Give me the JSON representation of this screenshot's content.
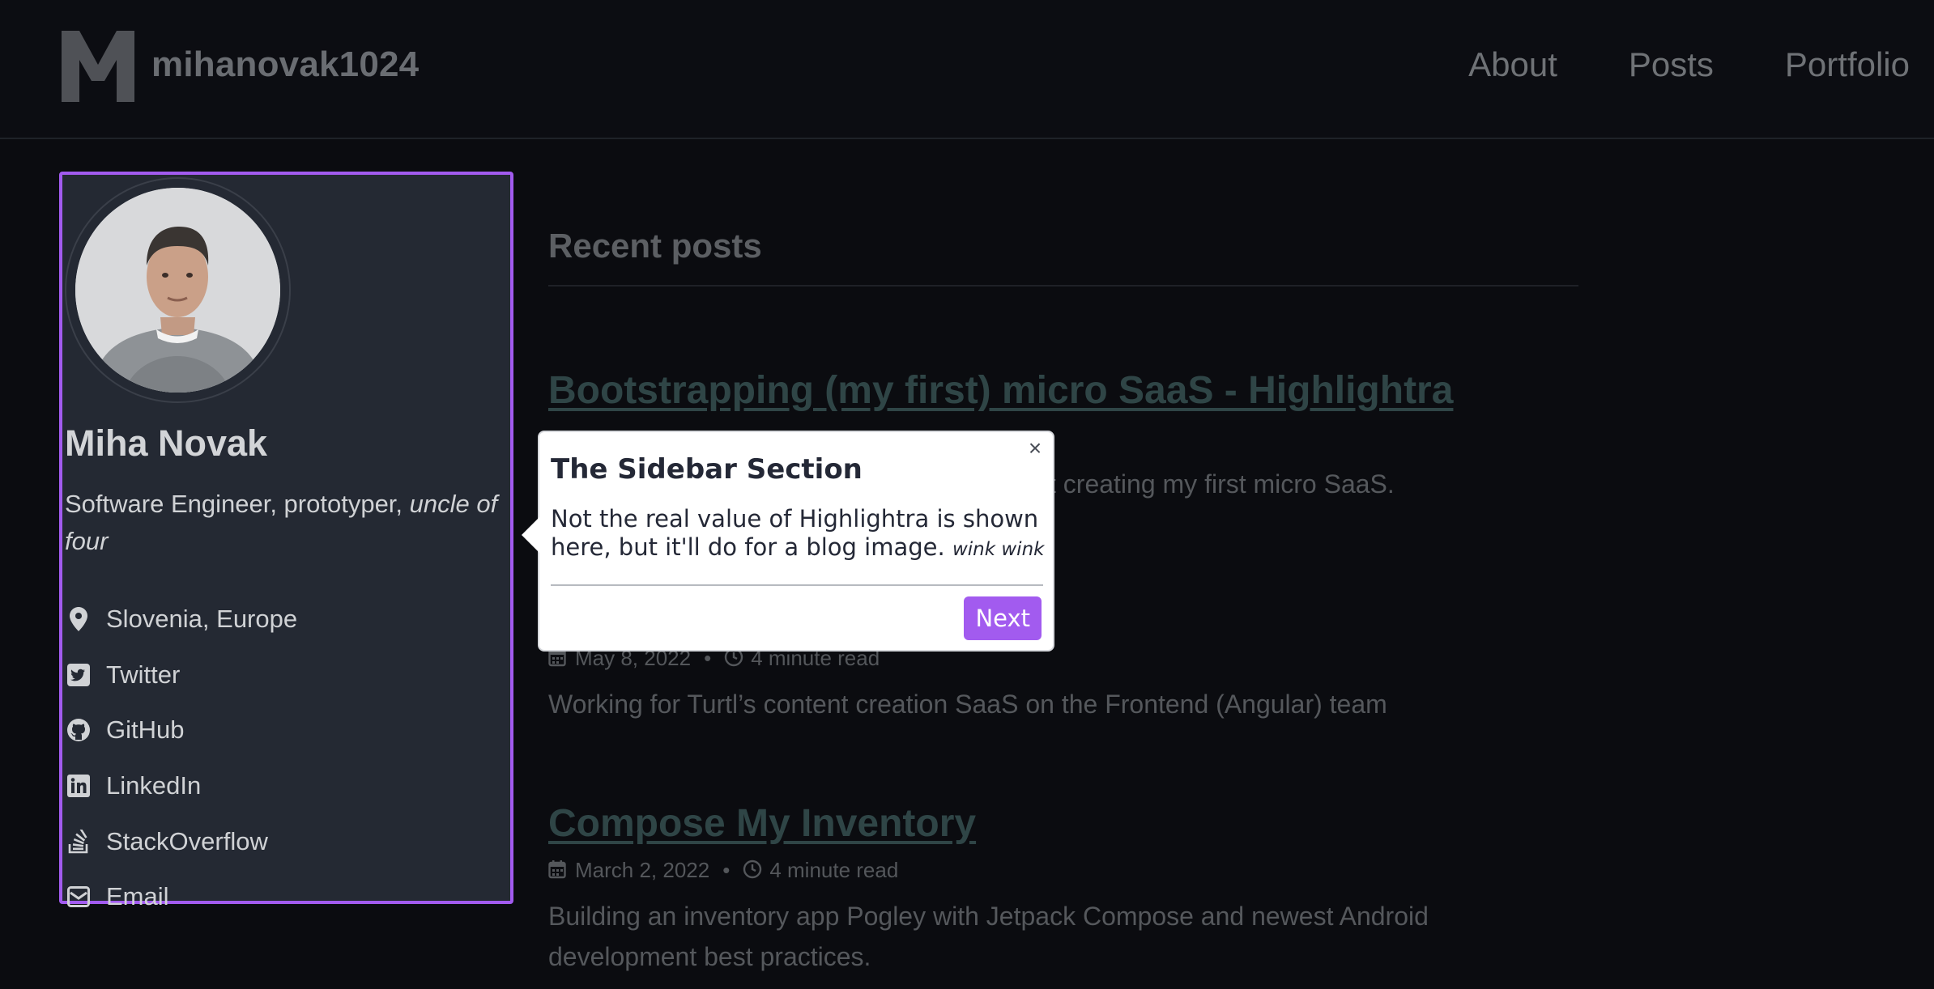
{
  "header": {
    "site_title": "mihanovak1024",
    "nav": [
      "About",
      "Posts",
      "Portfolio"
    ]
  },
  "sidebar": {
    "name": "Miha Novak",
    "bio_plain": "Software Engineer, prototyper, ",
    "bio_italic": "uncle of four",
    "links": [
      {
        "label": "Slovenia, Europe",
        "icon": "map-pin-icon"
      },
      {
        "label": "Twitter",
        "icon": "twitter-square-icon"
      },
      {
        "label": "GitHub",
        "icon": "github-icon"
      },
      {
        "label": "LinkedIn",
        "icon": "linkedin-icon"
      },
      {
        "label": "StackOverflow",
        "icon": "stackoverflow-icon"
      },
      {
        "label": "Email",
        "icon": "envelope-icon"
      }
    ]
  },
  "main": {
    "section_title": "Recent posts",
    "posts": [
      {
        "title": "Bootstrapping (my first) micro SaaS - Highlightra",
        "excerpt_visible": "t creating my first micro SaaS."
      },
      {
        "date": "May 8, 2022",
        "read_time": "4 minute read",
        "excerpt": "Working for Turtl’s content creation SaaS on the Frontend (Angular) team"
      },
      {
        "title": "Compose My Inventory",
        "date": "March 2, 2022",
        "read_time": "4 minute read",
        "excerpt": "Building an inventory app Pogley with Jetpack Compose and newest Android development best practices."
      }
    ],
    "meta_separator": "•"
  },
  "tour": {
    "title": "The Sidebar Section",
    "body": "Not the real value of Highlightra is shown here, but it'll do for a blog image.",
    "body_aside": "wink wink",
    "close_glyph": "×",
    "next_label": "Next"
  },
  "colors": {
    "accent": "#a25bef",
    "background": "#0b0c10",
    "sidebar": "#242933"
  }
}
